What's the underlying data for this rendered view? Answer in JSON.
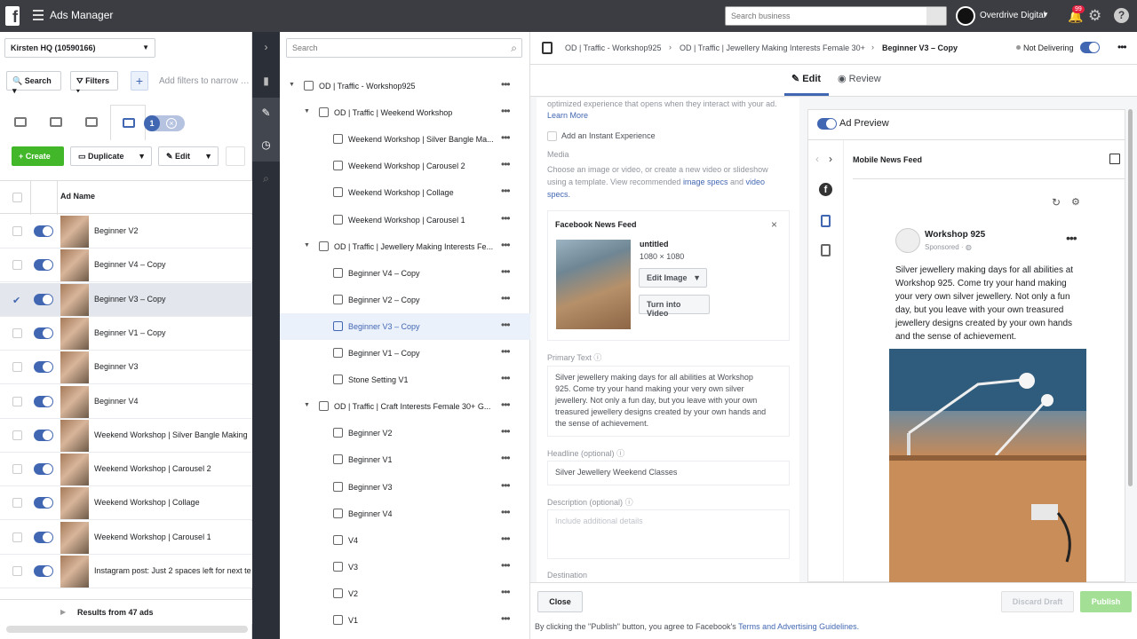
{
  "topbar": {
    "app_title": "Ads Manager",
    "search_placeholder": "Search business",
    "account_name": "Overdrive Digital",
    "notification_count": "99"
  },
  "leftpanel": {
    "account_selector": "Kirsten HQ (10590166)",
    "search_label": "Search",
    "filters_label": "Filters",
    "filter_hint": "Add filters to narrow the",
    "selected_count": "1",
    "create_label": "Create",
    "duplicate_label": "Duplicate",
    "edit_label": "Edit",
    "column_header": "Ad Name",
    "ads": [
      {
        "name": "Beginner V2",
        "selected": false
      },
      {
        "name": "Beginner V4 – Copy",
        "selected": false
      },
      {
        "name": "Beginner V3 – Copy",
        "selected": true
      },
      {
        "name": "Beginner V1 – Copy",
        "selected": false
      },
      {
        "name": "Beginner V3",
        "selected": false
      },
      {
        "name": "Beginner V4",
        "selected": false
      },
      {
        "name": "Weekend Workshop | Silver Bangle Making",
        "selected": false
      },
      {
        "name": "Weekend Workshop | Carousel 2",
        "selected": false
      },
      {
        "name": "Weekend Workshop | Collage",
        "selected": false
      },
      {
        "name": "Weekend Workshop | Carousel 1",
        "selected": false
      },
      {
        "name": "Instagram post: Just 2 spaces left for next te",
        "selected": false
      }
    ],
    "results_label": "Results from 47 ads"
  },
  "tree": {
    "search_placeholder": "Search",
    "nodes": [
      {
        "level": 0,
        "type": "campaign",
        "name": "OD | Traffic - Workshop925"
      },
      {
        "level": 1,
        "type": "adset",
        "name": "OD | Traffic | Weekend Workshop"
      },
      {
        "level": 2,
        "type": "ad",
        "name": "Weekend Workshop | Silver Bangle Ma..."
      },
      {
        "level": 2,
        "type": "ad",
        "name": "Weekend Workshop | Carousel 2"
      },
      {
        "level": 2,
        "type": "ad",
        "name": "Weekend Workshop | Collage"
      },
      {
        "level": 2,
        "type": "ad",
        "name": "Weekend Workshop | Carousel 1"
      },
      {
        "level": 1,
        "type": "adset",
        "name": "OD | Traffic | Jewellery Making Interests Fe..."
      },
      {
        "level": 2,
        "type": "ad",
        "name": "Beginner V4 – Copy"
      },
      {
        "level": 2,
        "type": "ad",
        "name": "Beginner V2 – Copy"
      },
      {
        "level": 2,
        "type": "ad",
        "name": "Beginner V3 – Copy",
        "selected": true
      },
      {
        "level": 2,
        "type": "ad",
        "name": "Beginner V1 – Copy"
      },
      {
        "level": 2,
        "type": "ad",
        "name": "Stone Setting V1"
      },
      {
        "level": 1,
        "type": "adset",
        "name": "OD | Traffic | Craft Interests Female 30+ G..."
      },
      {
        "level": 2,
        "type": "ad",
        "name": "Beginner V2"
      },
      {
        "level": 2,
        "type": "ad",
        "name": "Beginner V1"
      },
      {
        "level": 2,
        "type": "ad",
        "name": "Beginner V3"
      },
      {
        "level": 2,
        "type": "ad",
        "name": "Beginner V4"
      },
      {
        "level": 2,
        "type": "ad",
        "name": "V4"
      },
      {
        "level": 2,
        "type": "ad",
        "name": "V3"
      },
      {
        "level": 2,
        "type": "ad",
        "name": "V2"
      },
      {
        "level": 2,
        "type": "ad",
        "name": "V1"
      }
    ]
  },
  "editor": {
    "breadcrumb": [
      "OD | Traffic - Workshop925",
      "OD | Traffic | Jewellery Making Interests Female 30+",
      "Beginner V3 – Copy"
    ],
    "status": "Not Delivering",
    "tabs": {
      "edit": "Edit",
      "review": "Review"
    },
    "form": {
      "instant_text": "optimized experience that opens when they interact with your ad.",
      "learn_more": "Learn More",
      "instant_checkbox": "Add an Instant Experience",
      "media_label": "Media",
      "media_help_1": "Choose an image or video, or create a new video or slideshow",
      "media_help_2": "using a template. View recommended",
      "media_link_1": "image specs",
      "media_and": "and",
      "media_link_2": "video",
      "media_link_3": "specs.",
      "placement_card_title": "Facebook News Feed",
      "file_name": "untitled",
      "file_dims": "1080 × 1080",
      "edit_image": "Edit Image",
      "turn_into_video": "Turn into Video",
      "primary_text_label": "Primary Text",
      "primary_text": [
        "Silver jewellery making days for all abilities at Workshop",
        "925. Come try your hand making your very own silver",
        "jewellery. Not only a fun day, but you leave with your own",
        "treasured jewellery designs created by your own hands and",
        "the sense of achievement."
      ],
      "headline_label": "Headline (optional)",
      "headline_value": "Silver Jewellery Weekend Classes",
      "description_label": "Description (optional)",
      "description_placeholder": "Include additional details",
      "destination_label": "Destination"
    },
    "preview": {
      "title": "Ad Preview",
      "placement": "Mobile News Feed",
      "page_name": "Workshop 925",
      "sponsored": "Sponsored · ",
      "post_text": "Silver jewellery making days for all abilities at Workshop 925. Come try your hand making your very own silver jewellery. Not only a fun day, but you leave with your own treasured jewellery designs created by your own hands and the sense of achievement."
    },
    "footer": {
      "close": "Close",
      "discard": "Discard Draft",
      "publish": "Publish",
      "disclaimer_prefix": "By clicking the \"Publish\" button, you agree to Facebook's",
      "disclaimer_link": "Terms and Advertising Guidelines."
    }
  },
  "colors": {
    "brand_blue": "#4267b2",
    "create_green": "#42b72a",
    "topbar": "#3b3d42",
    "rail": "#2b2f38"
  }
}
